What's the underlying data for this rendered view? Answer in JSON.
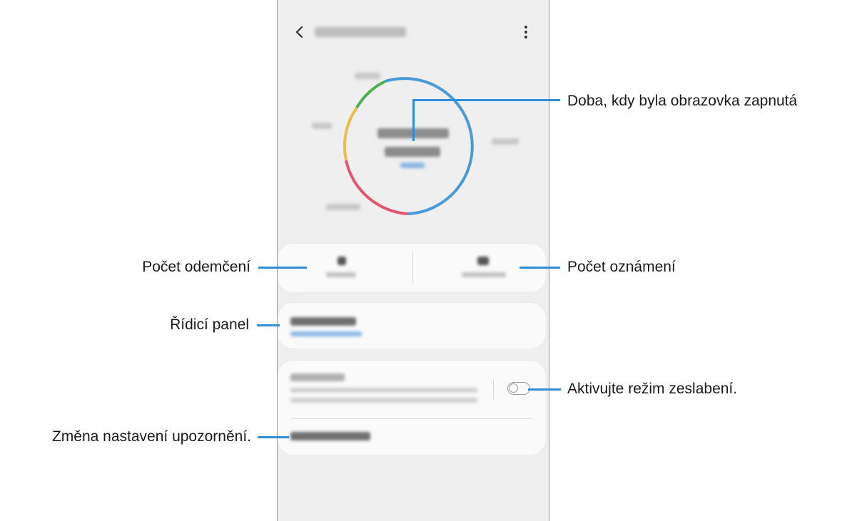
{
  "callouts": {
    "screen_time": "Doba, kdy byla obrazovka zapnutá",
    "unlocks": "Počet odemčení",
    "notifications_count": "Počet oznámení",
    "dashboard": "Řídicí panel",
    "wind_down": "Aktivujte režim zeslabení.",
    "notification_settings": "Změna nastavení upozornění."
  },
  "icons": {
    "back": "chevron-left-icon",
    "menu": "more-vertical-icon",
    "toggle": "toggle-off-icon"
  },
  "colors": {
    "leader_line": "#2f8ed8",
    "ring_blue": "#4a9ad8",
    "ring_green": "#4caf50",
    "ring_yellow": "#e6c04a",
    "ring_red": "#e0566e"
  }
}
